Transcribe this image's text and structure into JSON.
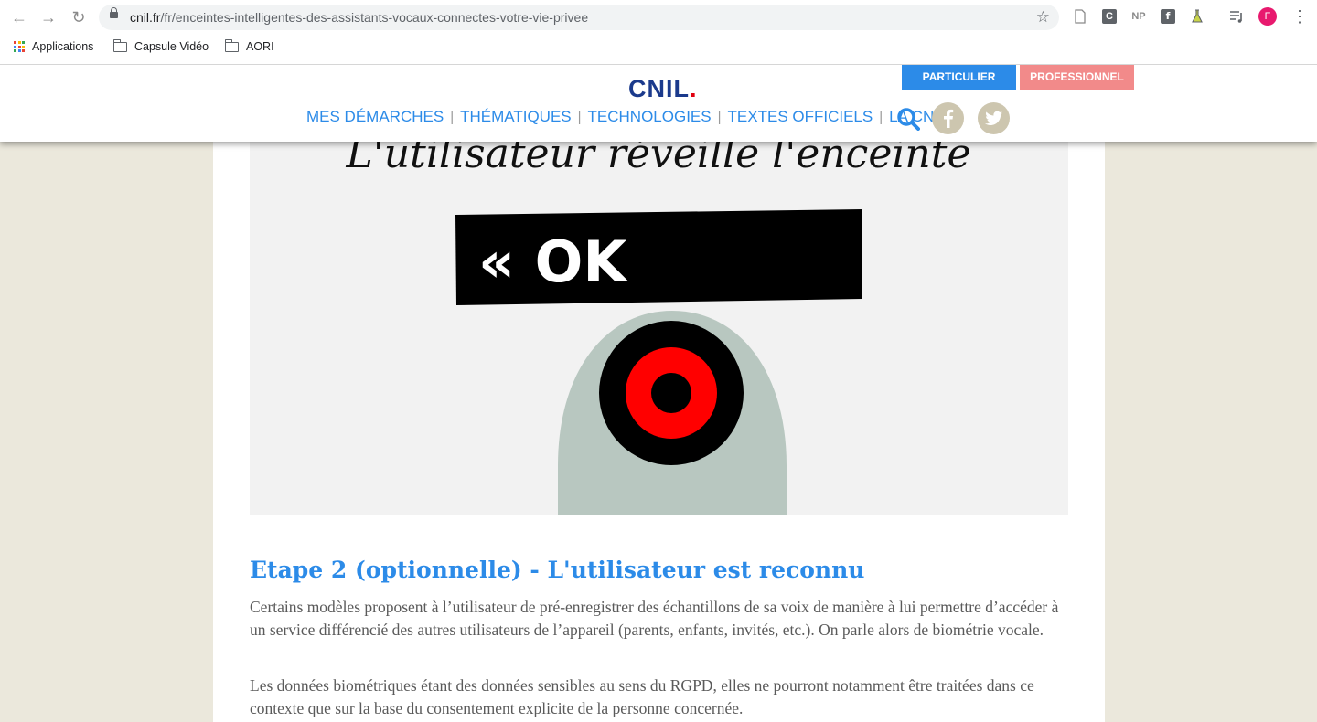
{
  "browser": {
    "url_host": "cnil.fr",
    "url_path": "/fr/enceintes-intelligentes-des-assistants-vocaux-connectes-votre-vie-privee",
    "profile_initial": "F",
    "extensions": [
      "C",
      "NP"
    ],
    "bookmarks": [
      {
        "label": "Applications",
        "icon": "apps-grid-icon"
      },
      {
        "label": "Capsule Vidéo",
        "icon": "folder-icon"
      },
      {
        "label": "AORI",
        "icon": "folder-icon"
      }
    ]
  },
  "site": {
    "logo_text": "CNIL",
    "logo_dot": ".",
    "audience_buttons": {
      "particulier": "PARTICULIER",
      "professionnel": "PROFESSIONNEL"
    },
    "menu": [
      "MES DÉMARCHES",
      "THÉMATIQUES",
      "TECHNOLOGIES",
      "TEXTES OFFICIELS",
      "LA CNIL"
    ],
    "colors": {
      "accent_blue": "#2c8be8",
      "logo_blue": "#1b3a8c",
      "pro_pink": "#f28a8a",
      "page_background": "#ebe8dc"
    }
  },
  "article": {
    "illustration": {
      "handwritten_caption": "L'utilisateur réveille l'enceinte",
      "speech_text": "« OK"
    },
    "heading": "Etape 2 (optionnelle) - L'utilisateur est reconnu",
    "paragraphs": [
      "Certains modèles proposent à l’utilisateur de pré-enregistrer des échantillons de sa voix de manière à lui permettre d’accéder à un service différencié des autres utilisateurs de l’appareil (parents, enfants, invités, etc.). On parle alors de biométrie vocale.",
      "Les données biométriques étant des données sensibles au sens du RGPD, elles ne pourront notamment être traitées dans ce contexte que sur la base du consentement explicite de la personne concernée."
    ]
  }
}
